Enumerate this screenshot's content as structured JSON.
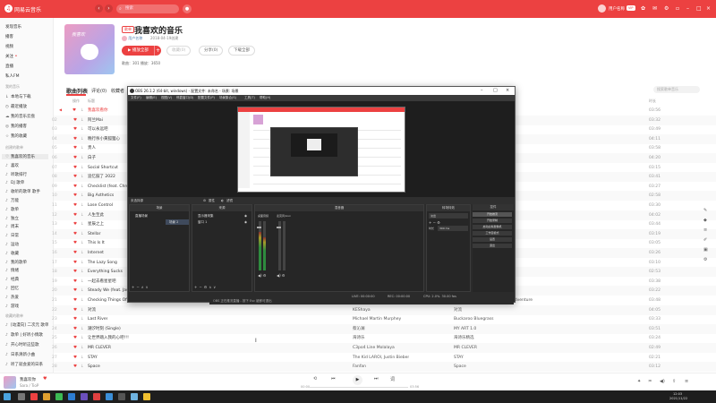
{
  "app": {
    "name": "网易云音乐",
    "search_placeholder": "搜索",
    "user_name": "用户名称",
    "vip": "VIP"
  },
  "sidebar": {
    "top_items": [
      "发现音乐",
      "播客",
      "视频",
      "关注",
      "直播",
      "私人FM"
    ],
    "my_music_title": "我的音乐",
    "my_items": [
      "本地与下载",
      "最近播放",
      "我的音乐云盘",
      "我的播客",
      "我的收藏"
    ],
    "created_title": "创建的歌单",
    "created_items": [
      "我喜欢的音乐",
      "喜欢",
      "听歌排行",
      "DJ 歌单",
      "收听的歌单 歌手",
      "万能",
      "歌单",
      "独立",
      "周末",
      "日常",
      "运动",
      "收藏",
      "我的歌单",
      "情绪",
      "经典",
      "回忆",
      "热爱",
      "游戏"
    ],
    "collected_title": "收藏的歌单",
    "collected_items": [
      "[动漫向] 二次元 歌单",
      "歌单 | 好听小情歌",
      "开心时听这些歌",
      "日系清新小曲",
      "听了就会爱的日系"
    ]
  },
  "playlist": {
    "tag": "歌单",
    "title": "我喜欢的音乐",
    "creator": "用户名称",
    "created": "2018-04-19创建",
    "cover_text": "我喜欢",
    "play_all": "播放全部",
    "add": "+",
    "collect": "收藏(0)",
    "share": "分享(0)",
    "download": "下载全部",
    "meta": "歌曲：301   播放：3650"
  },
  "tabs": {
    "songs": "歌曲列表",
    "comments": "评论(0)",
    "collectors": "收藏者"
  },
  "list_search": "搜索歌单音乐",
  "columns": {
    "op": "操作",
    "title": "标题",
    "artist": "歌手",
    "album": "专辑",
    "duration": "时长"
  },
  "songs": [
    {
      "n": "01",
      "title": "我喜欢看你",
      "artist": "",
      "album": "",
      "dur": "03:56",
      "hl": true
    },
    {
      "n": "02",
      "title": "阿兰Mai",
      "artist": "",
      "album": "",
      "dur": "03:32"
    },
    {
      "n": "03",
      "title": "可以永远吧",
      "artist": "",
      "album": "",
      "dur": "03:49"
    },
    {
      "n": "04",
      "title": "晚行杀小黄狐狸心",
      "artist": "",
      "album": "",
      "dur": "04:11"
    },
    {
      "n": "05",
      "title": "贵人",
      "artist": "",
      "album": "",
      "dur": "03:58"
    },
    {
      "n": "06",
      "title": "白子",
      "artist": "",
      "album": "",
      "dur": "04:20"
    },
    {
      "n": "07",
      "title": "Social Shortcut",
      "artist": "",
      "album": "",
      "dur": "03:15"
    },
    {
      "n": "08",
      "title": "追忆鼓了 2022",
      "artist": "",
      "album": "",
      "dur": "03:41"
    },
    {
      "n": "09",
      "title": "Checklist (feat. Chromeo)",
      "artist": "",
      "album": "",
      "dur": "03:27"
    },
    {
      "n": "10",
      "title": "Big Asthetics",
      "artist": "",
      "album": "",
      "dur": "02:58"
    },
    {
      "n": "11",
      "title": "Lose Control",
      "artist": "",
      "album": "",
      "dur": "03:30"
    },
    {
      "n": "12",
      "title": "人生至此",
      "artist": "",
      "album": "",
      "dur": "04:02"
    },
    {
      "n": "13",
      "title": "星辰之上",
      "artist": "",
      "album": "",
      "dur": "03:44"
    },
    {
      "n": "14",
      "title": "Stellar",
      "artist": "",
      "album": "",
      "dur": "03:19"
    },
    {
      "n": "15",
      "title": "This Is It",
      "artist": "",
      "album": "",
      "dur": "03:05"
    },
    {
      "n": "16",
      "title": "Internet",
      "artist": "",
      "album": "",
      "dur": "03:26"
    },
    {
      "n": "17",
      "title": "The Lazy Song",
      "artist": "",
      "album": "",
      "dur": "03:10"
    },
    {
      "n": "18",
      "title": "Everything Sucks",
      "artist": "",
      "album": "",
      "dur": "02:53"
    },
    {
      "n": "19",
      "title": "一起去看星星吧",
      "artist": "",
      "album": "",
      "dur": "03:38"
    },
    {
      "n": "20",
      "title": "Steady We (feat. Jasper)",
      "artist": "",
      "album": "",
      "dur": "03:22"
    },
    {
      "n": "21",
      "title": "Checking Things Off A List",
      "artist": "",
      "album": "Checking Things Off A List... Adventure",
      "dur": "03:48"
    },
    {
      "n": "22",
      "title": "对流",
      "artist": "KEShaya",
      "album": "对流",
      "dur": "04:05"
    },
    {
      "n": "23",
      "title": "Last River",
      "artist": "Michael Martin Murphey",
      "album": "Buckaroo Bluegrass",
      "dur": "03:33"
    },
    {
      "n": "24",
      "title": "潮汐时刻 (Single)",
      "artist": "蔡沁澜",
      "album": "MY ART 1.0",
      "dur": "03:51"
    },
    {
      "n": "25",
      "title": "让世界踏入我的心吧!!!",
      "artist": "海诗乐",
      "album": "海诗乐精选",
      "dur": "03:24"
    },
    {
      "n": "26",
      "title": "MR CLEVER",
      "artist": "C3po4 Line Molalaya",
      "album": "MR CLEVER",
      "dur": "02:49"
    },
    {
      "n": "27",
      "title": "STAY",
      "artist": "The Kid LAROI, Justin Bieber",
      "album": "STAY",
      "dur": "02:21"
    },
    {
      "n": "28",
      "title": "Space",
      "artist": "Fanfan",
      "album": "Space",
      "dur": "03:12"
    }
  ],
  "player": {
    "title": "我喜欢你",
    "artist": "Sara / TioP",
    "elapsed": "00:00",
    "total": "03:56"
  },
  "taskbar": {
    "time": "12:03",
    "date": "2021/11/22"
  },
  "obs": {
    "title": "OBS 26.1.2 (64-bit, windows) - 配置文件: 未命名 - 场景: 场景",
    "menu": [
      "文件(F)",
      "编辑(E)",
      "视图(V)",
      "停靠窗口(D)",
      "配置文件(P)",
      "场景集合(S)",
      "工具(T)",
      "帮助(H)"
    ],
    "source_label": "未选择源",
    "props": "属性",
    "filters": "滤镜",
    "docks": {
      "scenes": "场景",
      "sources": "来源",
      "mixer": "混音器",
      "transitions": "转场特效",
      "controls": "控件"
    },
    "scenes": [
      "直播场景",
      "场景 2"
    ],
    "sources": [
      "显示器采集",
      "窗口 1"
    ],
    "mixer": [
      "桌面音频",
      "麦克风/Aux"
    ],
    "transition": "淡出",
    "duration_label": "时长",
    "duration": "300 ms",
    "controls": [
      "开始推流",
      "开始录制",
      "启动虚拟摄像机",
      "工作室模式",
      "设置",
      "退出"
    ],
    "status": {
      "live": "LIVE: 00:00:00",
      "rec": "REC: 00:00:00",
      "cpu": "CPU: 2.0%, 30.00 fps"
    },
    "below": "OBS 正在推流直播 - 按下 Esc 键即可退出"
  }
}
